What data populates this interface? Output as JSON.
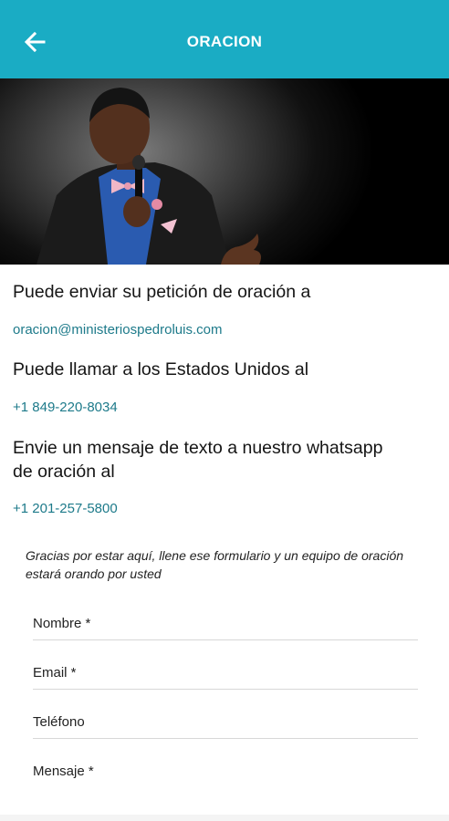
{
  "header": {
    "title": "ORACION",
    "back_icon": "arrow-left-icon"
  },
  "hero": {
    "image": "photo of preacher speaking into a microphone"
  },
  "contact": {
    "email_intro": "Puede enviar su petición de oración a",
    "email": "oracion@ministeriospedroluis.com",
    "phone_intro": "Puede llamar a los Estados Unidos al",
    "phone": "+1 849-220-8034",
    "whatsapp_intro_line1": "Envie un mensaje de texto a nuestro whatsapp",
    "whatsapp_intro_line2": "de oración al",
    "whatsapp": "+1 201-257-5800"
  },
  "form": {
    "note": "Gracias por estar aquí, llene ese formulario y un equipo de oración estará orando por usted",
    "fields": [
      "Nombre *",
      "Email *",
      "Teléfono",
      "Mensaje *"
    ]
  },
  "colors": {
    "accent": "#1aacc4",
    "link": "#1d7a8a"
  }
}
